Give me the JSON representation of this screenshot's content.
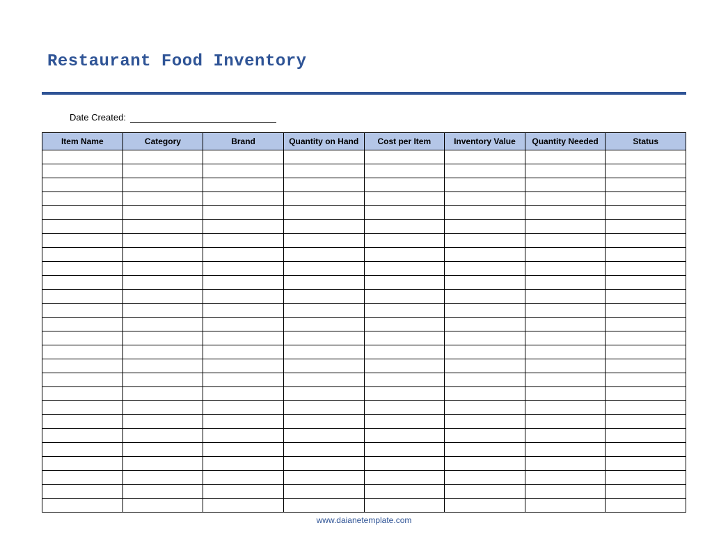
{
  "title": "Restaurant Food Inventory",
  "date_label": "Date Created:",
  "date_value": "",
  "columns": [
    "Item Name",
    "Category",
    "Brand",
    "Quantity on Hand",
    "Cost per Item",
    "Inventory Value",
    "Quantity Needed",
    "Status"
  ],
  "row_count": 26,
  "footer": "www.daianetemplate.com",
  "colors": {
    "accent": "#2f5496",
    "header_bg": "#b4c6e7"
  }
}
